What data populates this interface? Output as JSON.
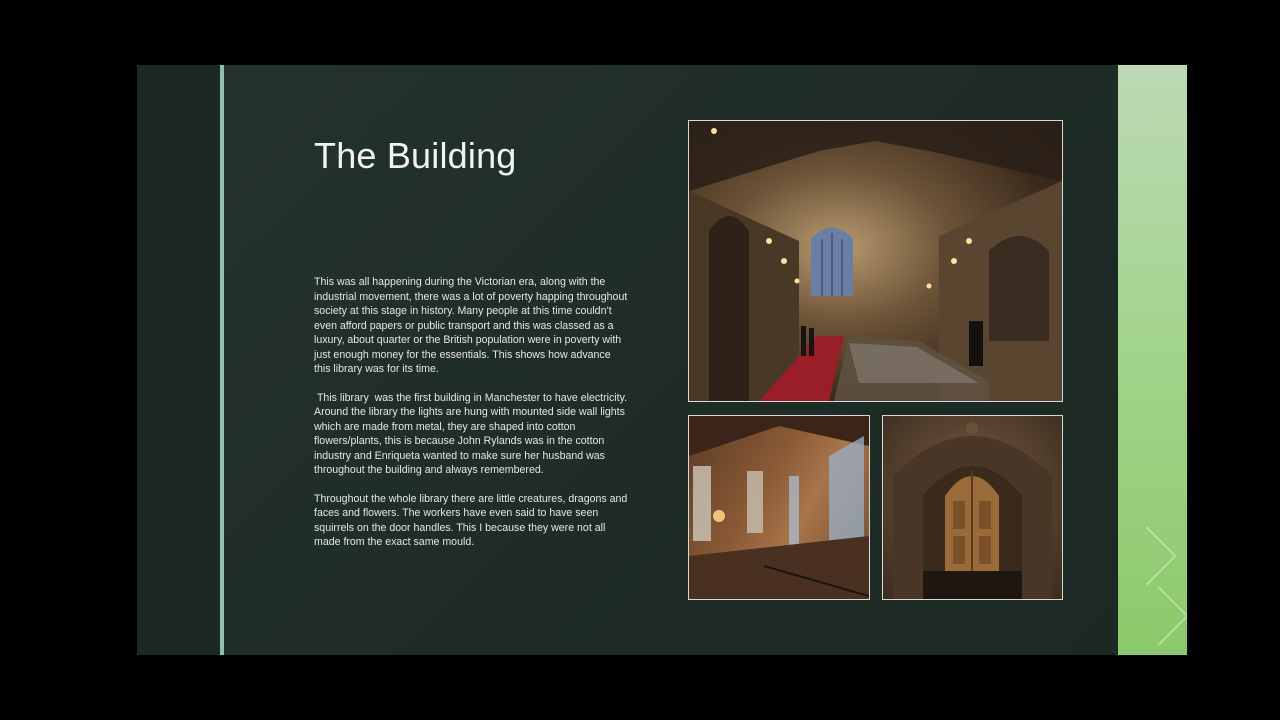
{
  "slide": {
    "title": "The Building",
    "paragraphs": [
      "This was all happening during the Victorian era, along with the industrial movement, there was a lot of poverty happing throughout society at this stage in history. Many people at this time couldn’t even afford papers or public transport and this was classed as a luxury, about quarter or the British population were in poverty with just enough money for the essentials. This shows how advance this library was for its time.",
      " This library  was the first building in Manchester to have electricity. Around the library the lights are hung with mounted side wall lights which are made from metal, they are shaped into cotton flowers/plants, this is because John Rylands was in the cotton industry and Enriqueta wanted to make sure her husband was throughout the building and always remembered.",
      "Throughout the whole library there are little creatures, dragons and faces and flowers. The workers have even said to have seen squirrels on the door handles. This I because they were not all made from the exact same mould."
    ]
  },
  "colors": {
    "background": "#000000",
    "slide": "#22302a",
    "accent_line": "#8fbfb4",
    "right_band": "#a4d48e",
    "title_text": "#f2f2f2",
    "body_text": "#e6e6e6"
  }
}
